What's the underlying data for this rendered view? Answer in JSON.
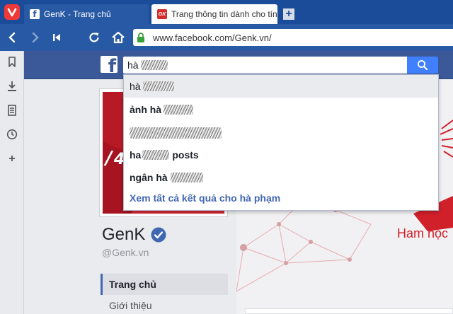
{
  "browser": {
    "tabs": [
      {
        "label": "GenK - Trang chủ",
        "active": true,
        "favicon": "facebook-icon"
      },
      {
        "label": "Trang thông tin dành cho tín",
        "active": false,
        "favicon": "genk-icon"
      }
    ],
    "url": "www.facebook.com/Genk.vn/"
  },
  "search": {
    "query": "hà",
    "suggestions": [
      {
        "prefix": "hà",
        "suffix": ""
      },
      {
        "prefix": "ảnh hà",
        "suffix": ""
      },
      {
        "prefix": "",
        "suffix": ""
      },
      {
        "prefix": "ha",
        "suffix": "posts"
      },
      {
        "prefix": "ngân hà",
        "suffix": ""
      }
    ],
    "see_all": "Xem tất cả kết quả cho hà phạm"
  },
  "page": {
    "name": "GenK",
    "handle": "@Genk.vn",
    "cover_tagline": "Ham học",
    "nav": {
      "active": "Trang chủ",
      "next": "Giới thiệu"
    }
  },
  "colors": {
    "fb_blue": "#3b5998",
    "browser_blue": "#2759a5",
    "search_button": "#4080ff",
    "brand_red": "#d0202a"
  }
}
